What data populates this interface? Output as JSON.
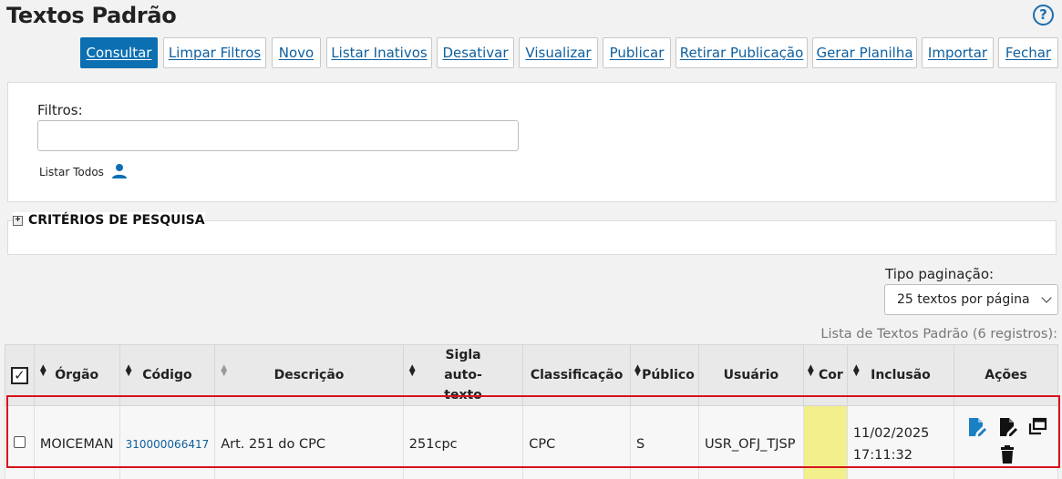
{
  "page": {
    "title": "Textos Padrão"
  },
  "toolbar": {
    "buttons": [
      {
        "label": "Consultar"
      },
      {
        "label": "Limpar Filtros"
      },
      {
        "label": "Novo"
      },
      {
        "label": "Listar Inativos"
      },
      {
        "label": "Desativar"
      },
      {
        "label": "Visualizar"
      },
      {
        "label": "Publicar"
      },
      {
        "label": "Retirar Publicação"
      },
      {
        "label": "Gerar Planilha"
      },
      {
        "label": "Importar"
      },
      {
        "label": "Fechar"
      }
    ]
  },
  "filters": {
    "label": "Filtros:",
    "value": "",
    "list_all": "Listar Todos"
  },
  "criteria": {
    "title": "CRITÉRIOS DE PESQUISA"
  },
  "pagination": {
    "label": "Tipo paginação:",
    "selected": "25 textos por página"
  },
  "list": {
    "count_text": "Lista de Textos Padrão (6 registros):"
  },
  "table": {
    "headers": {
      "orgao": "Órgão",
      "codigo": "Código",
      "descricao": "Descrição",
      "sigla": "Sigla auto-texto",
      "classificacao": "Classificação",
      "publico": "Público",
      "usuario": "Usuário",
      "cor": "Cor",
      "inclusao": "Inclusão",
      "acoes": "Ações"
    },
    "rows": [
      {
        "orgao": "MOICEMAN",
        "codigo": "310000066417",
        "descricao": "Art. 251 do CPC",
        "sigla": "251cpc",
        "classificacao": "CPC",
        "publico": "S",
        "usuario": "USR_OFJ_TJSP",
        "cor": "#f2ef8c",
        "inclusao_date": "11/02/2025",
        "inclusao_time": "17:11:32"
      }
    ]
  },
  "colors": {
    "primary": "#0b6fb2",
    "link": "#0e5f9e",
    "highlight": "#d8131d"
  }
}
